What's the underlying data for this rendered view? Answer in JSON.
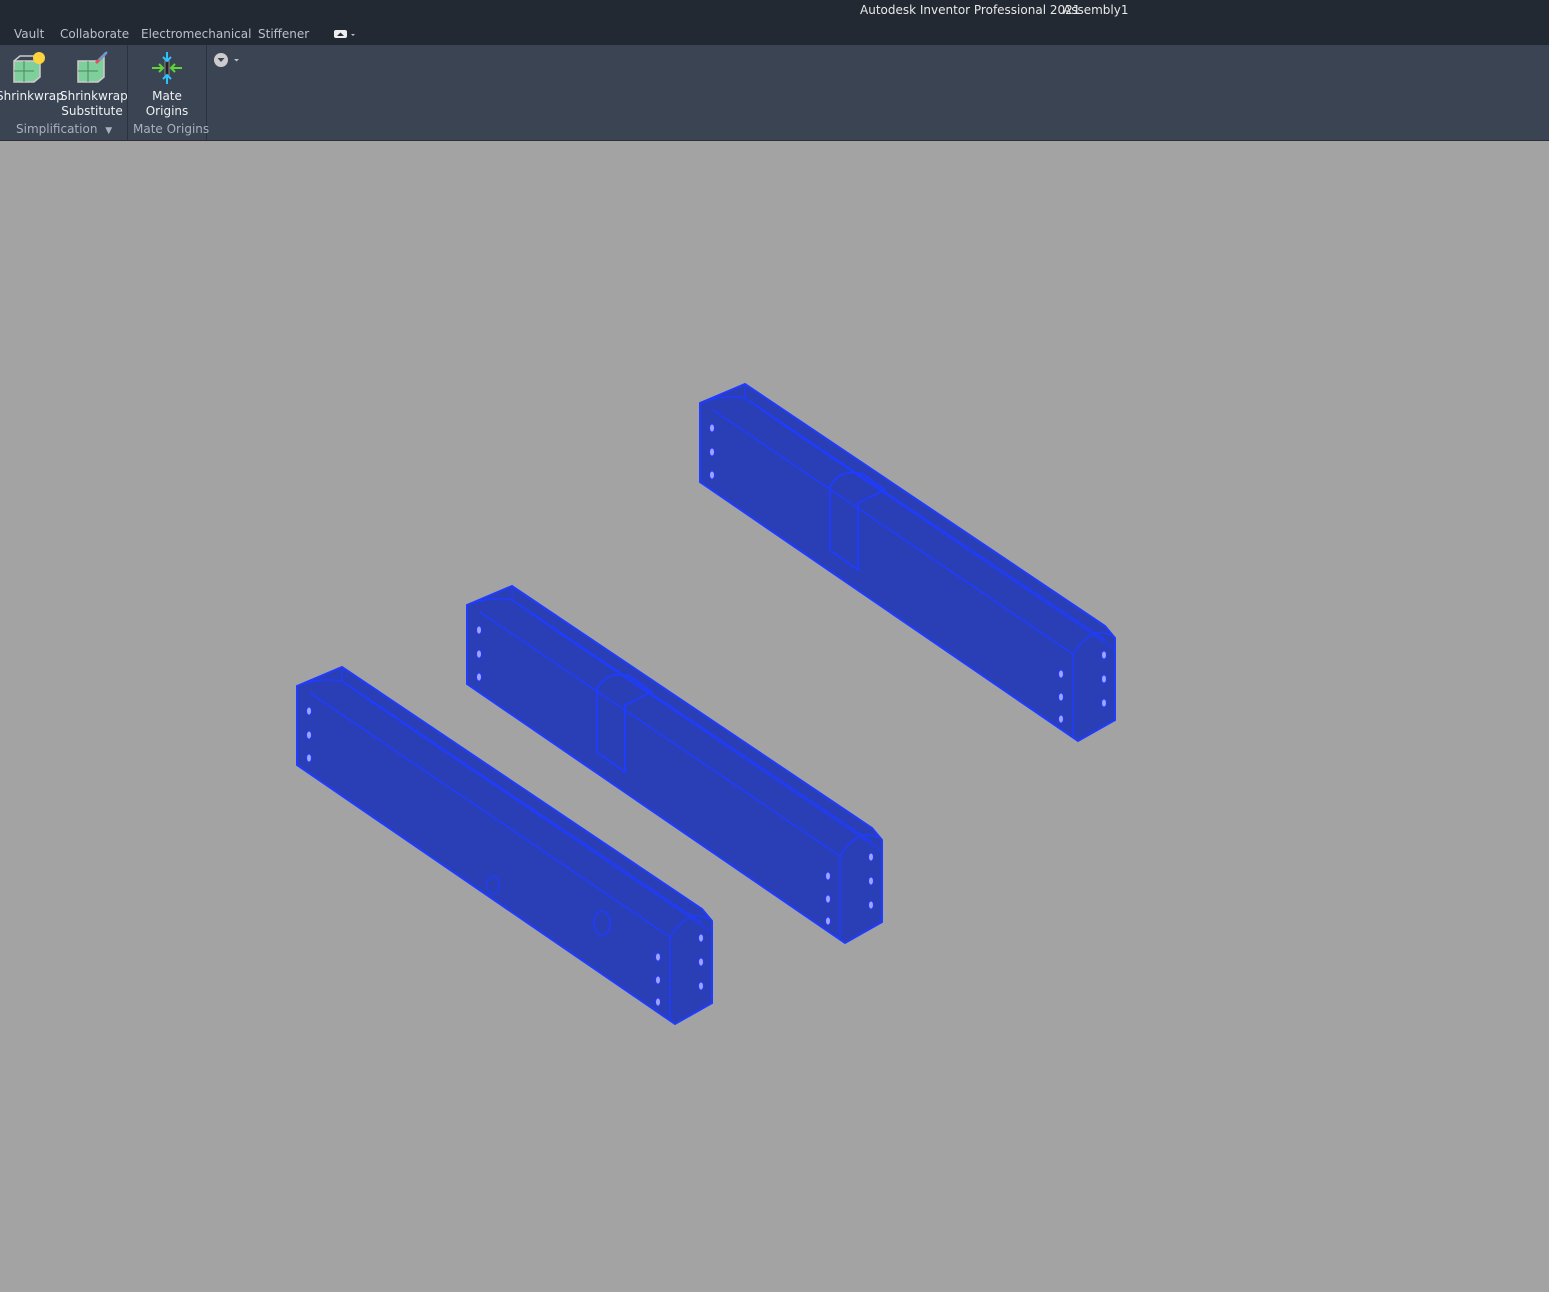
{
  "titlebar": {
    "app": "Autodesk Inventor Professional 2021",
    "document": "Assembly1"
  },
  "tabs": [
    "Vault",
    "Collaborate",
    "Electromechanical",
    "Stiffener"
  ],
  "ribbon": {
    "buttons": [
      {
        "label": "Shrinkwrap",
        "icon": "shrinkwrap-icon"
      },
      {
        "label": "Shrinkwrap",
        "label2": "Substitute",
        "icon": "shrinkwrap-substitute-icon"
      },
      {
        "label": "Mate Origins",
        "icon": "mate-origins-icon"
      }
    ],
    "panels": [
      "Simplification",
      "Mate Origins"
    ]
  },
  "viewport": {
    "background": "#a3a3a3",
    "part_color": "#2a3fb5",
    "edge_color": "#1f3cff",
    "part_count": 3
  }
}
